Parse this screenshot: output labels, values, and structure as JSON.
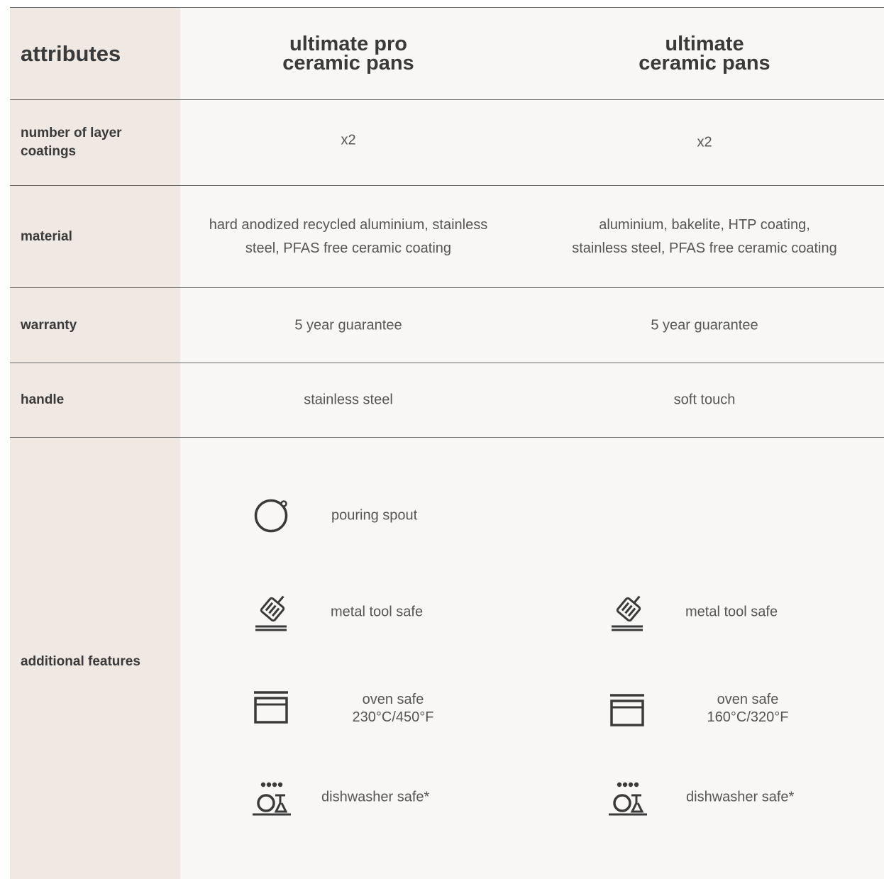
{
  "header": {
    "attributes_label": "attributes",
    "columns": [
      {
        "line1": "ultimate pro",
        "line2": "ceramic pans"
      },
      {
        "line1": "ultimate",
        "line2": "ceramic pans"
      }
    ]
  },
  "rows": [
    {
      "label": "number of layer coatings",
      "a": "x2",
      "b": "x2"
    },
    {
      "label": "material",
      "a_line1": "hard anodized recycled aluminium, stainless",
      "a_line2": "steel, PFAS free ceramic coating",
      "b_line1": "aluminium, bakelite, HTP coating,",
      "b_line2": "stainless steel, PFAS free ceramic coating"
    },
    {
      "label": "warranty",
      "a": "5 year guarantee",
      "b": "5 year guarantee"
    },
    {
      "label": "handle",
      "a": "stainless steel",
      "b": "soft touch"
    }
  ],
  "features": {
    "label": "additional features",
    "a": [
      {
        "icon": "pouring-spout-icon",
        "line1": "pouring spout"
      },
      {
        "icon": "metal-tool-safe-icon",
        "line1": "metal tool safe"
      },
      {
        "icon": "oven-safe-icon",
        "line1": "oven safe",
        "line2": "230°C/450°F"
      },
      {
        "icon": "dishwasher-safe-icon",
        "line1": "dishwasher safe*"
      }
    ],
    "b": [
      {
        "icon": "metal-tool-safe-icon",
        "line1": "metal tool safe"
      },
      {
        "icon": "oven-safe-icon",
        "line1": "oven safe",
        "line2": "160°C/320°F"
      },
      {
        "icon": "dishwasher-safe-icon",
        "line1": "dishwasher safe*"
      }
    ]
  },
  "colors": {
    "attribute_column_bg": "#efe8e3",
    "table_bg": "#f8f7f5",
    "divider": "#6b6b6b",
    "text": "#3a3a3a"
  }
}
